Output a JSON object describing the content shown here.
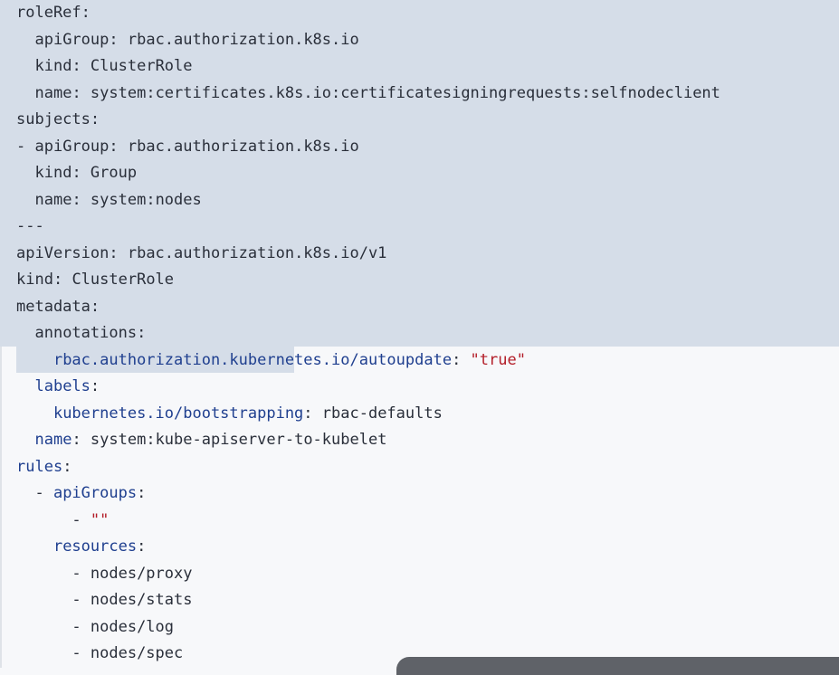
{
  "selection": {
    "color": "#d5dde8"
  },
  "lines": [
    {
      "indent": "",
      "key": "roleRef",
      "sep": ":",
      "value": "",
      "key_color": "v"
    },
    {
      "indent": "  ",
      "key": "apiGroup",
      "sep": ": ",
      "value": "rbac.authorization.k8s.io",
      "key_color": "v"
    },
    {
      "indent": "  ",
      "key": "kind",
      "sep": ": ",
      "value": "ClusterRole",
      "key_color": "v"
    },
    {
      "indent": "  ",
      "key": "name",
      "sep": ": ",
      "value": "system:certificates.k8s.io:certificatesigningrequests:selfnodeclient",
      "key_color": "v"
    },
    {
      "indent": "",
      "key": "subjects",
      "sep": ":",
      "value": "",
      "key_color": "v"
    },
    {
      "indent": "- ",
      "key": "apiGroup",
      "sep": ": ",
      "value": "rbac.authorization.k8s.io",
      "key_color": "v"
    },
    {
      "indent": "  ",
      "key": "kind",
      "sep": ": ",
      "value": "Group",
      "key_color": "v"
    },
    {
      "indent": "  ",
      "key": "name",
      "sep": ": ",
      "value": "system:nodes",
      "key_color": "v"
    },
    {
      "indent": "",
      "key": "---",
      "sep": "",
      "value": "",
      "key_color": "v"
    },
    {
      "indent": "",
      "key": "apiVersion",
      "sep": ": ",
      "value": "rbac.authorization.k8s.io/v1",
      "key_color": "v"
    },
    {
      "indent": "",
      "key": "kind",
      "sep": ": ",
      "value": "ClusterRole",
      "key_color": "v"
    },
    {
      "indent": "",
      "key": "metadata",
      "sep": ":",
      "value": "",
      "key_color": "v"
    },
    {
      "indent": "  ",
      "key": "annotations",
      "sep": ":",
      "value": "",
      "key_color": "v"
    },
    {
      "indent": "    ",
      "key": "rbac.authorization.kubernetes.io/autoupdate",
      "sep": ": ",
      "value": "\"true\"",
      "key_color": "k",
      "value_color": "s"
    },
    {
      "indent": "  ",
      "key": "labels",
      "sep": ":",
      "value": "",
      "key_color": "k"
    },
    {
      "indent": "    ",
      "key": "kubernetes.io/bootstrapping",
      "sep": ": ",
      "value": "rbac-defaults",
      "key_color": "k"
    },
    {
      "indent": "  ",
      "key": "name",
      "sep": ": ",
      "value": "system:kube-apiserver-to-kubelet",
      "key_color": "k"
    },
    {
      "indent": "",
      "key": "rules",
      "sep": ":",
      "value": "",
      "key_color": "k"
    },
    {
      "indent": "  - ",
      "key": "apiGroups",
      "sep": ":",
      "value": "",
      "key_color": "k"
    },
    {
      "indent": "      - ",
      "key": "",
      "sep": "",
      "value": "\"\"",
      "key_color": "k",
      "value_color": "s"
    },
    {
      "indent": "    ",
      "key": "resources",
      "sep": ":",
      "value": "",
      "key_color": "k"
    },
    {
      "indent": "      - ",
      "key": "",
      "sep": "",
      "value": "nodes/proxy",
      "key_color": "k"
    },
    {
      "indent": "      - ",
      "key": "",
      "sep": "",
      "value": "nodes/stats",
      "key_color": "k"
    },
    {
      "indent": "      - ",
      "key": "",
      "sep": "",
      "value": "nodes/log",
      "key_color": "k"
    },
    {
      "indent": "      - ",
      "key": "",
      "sep": "",
      "value": "nodes/spec",
      "key_color": "k"
    }
  ]
}
